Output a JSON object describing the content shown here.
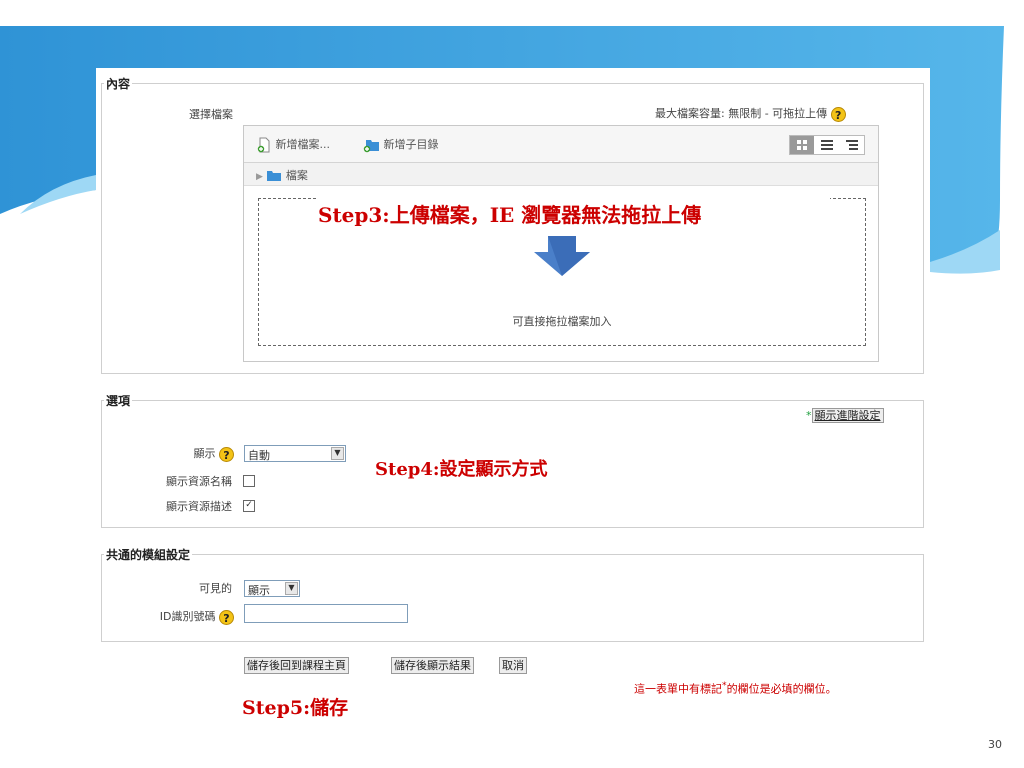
{
  "colors": {
    "banner_top": "#3aa1de",
    "banner_light": "#8fd0f3",
    "step_red": "#cc0000"
  },
  "content_section": {
    "legend": "內容",
    "select_file_label": "選擇檔案",
    "max_size_text": "最大檔案容量: 無限制 - 可拖拉上傳",
    "toolbar": {
      "add_file": "新增檔案...",
      "add_folder": "新增子目錄"
    },
    "path": "檔案",
    "drop_hint": "可直接拖拉檔案加入",
    "step3": "Step3:上傳檔案，IE 瀏覽器無法拖拉上傳"
  },
  "options_section": {
    "legend": "選項",
    "advanced_link": "顯示進階設定",
    "display_label": "顯示",
    "display_value": "自動",
    "show_name_label": "顯示資源名稱",
    "show_name_checked": false,
    "show_desc_label": "顯示資源描述",
    "show_desc_checked": true,
    "step4": "Step4:設定顯示方式"
  },
  "common_section": {
    "legend": "共通的模組設定",
    "visible_label": "可見的",
    "visible_value": "顯示",
    "id_label": "ID識別號碼"
  },
  "buttons": {
    "save_return": "儲存後回到課程主頁",
    "save_display": "儲存後顯示結果",
    "cancel": "取消"
  },
  "required_note": {
    "before": "這一表單中有標記",
    "star": "*",
    "after": "的欄位是必填的欄位。"
  },
  "step5": "Step5:儲存",
  "page_number": "30"
}
